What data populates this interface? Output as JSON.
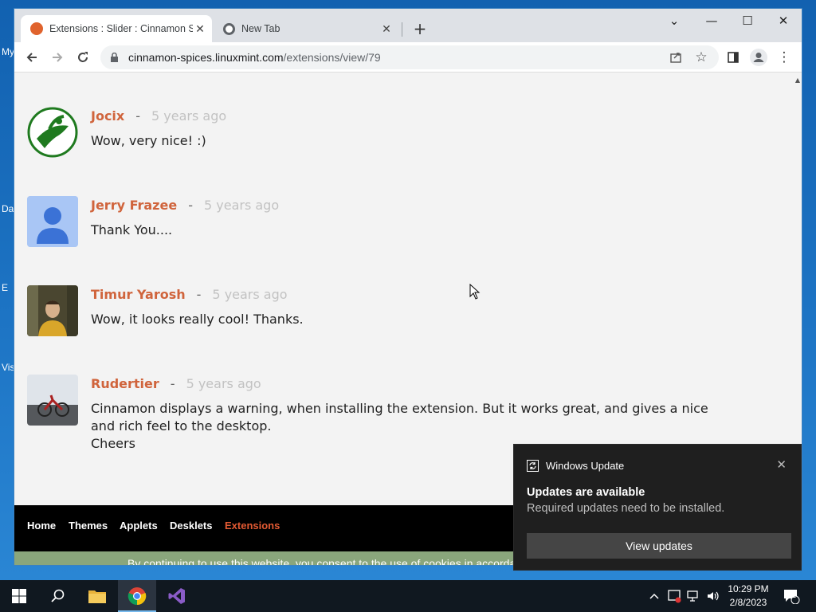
{
  "desktop": {
    "labels": [
      "My",
      "Da",
      "E",
      "Vis"
    ]
  },
  "browser": {
    "tabs": [
      {
        "title": "Extensions : Slider : Cinnamon Spices",
        "active": true
      },
      {
        "title": "New Tab",
        "active": false
      }
    ],
    "url_host": "cinnamon-spices.linuxmint.com",
    "url_path": "/extensions/view/79"
  },
  "comments": [
    {
      "author": "Jocix",
      "time": "5 years ago",
      "lines": [
        "Wow, very nice! :)"
      ]
    },
    {
      "author": "Jerry Frazee",
      "time": "5 years ago",
      "lines": [
        "Thank You...."
      ]
    },
    {
      "author": "Timur Yarosh",
      "time": "5 years ago",
      "lines": [
        "Wow, it looks really cool! Thanks."
      ]
    },
    {
      "author": "Rudertier",
      "time": "5 years ago",
      "lines": [
        "Cinnamon displays a warning, when installing the extension. But it works great, and gives a nice and rich feel to the desktop.",
        "Cheers"
      ]
    }
  ],
  "separator": "-",
  "footer_nav": {
    "items": [
      "Home",
      "Themes",
      "Applets",
      "Desklets",
      "Extensions"
    ],
    "current": "Extensions"
  },
  "cookie_text": "By continuing to use this website, you consent to the use of cookies in accordance with our Cookie Policy",
  "toast": {
    "app_name": "Windows Update",
    "title": "Updates are available",
    "body": "Required updates need to be installed.",
    "button": "View updates"
  },
  "taskbar": {
    "time": "10:29 PM",
    "date": "2/8/2023",
    "notification_count": "1"
  },
  "colors": {
    "author": "#d0643c",
    "nav_current": "#e35a33",
    "cookie_bar": "#8aa67c"
  }
}
